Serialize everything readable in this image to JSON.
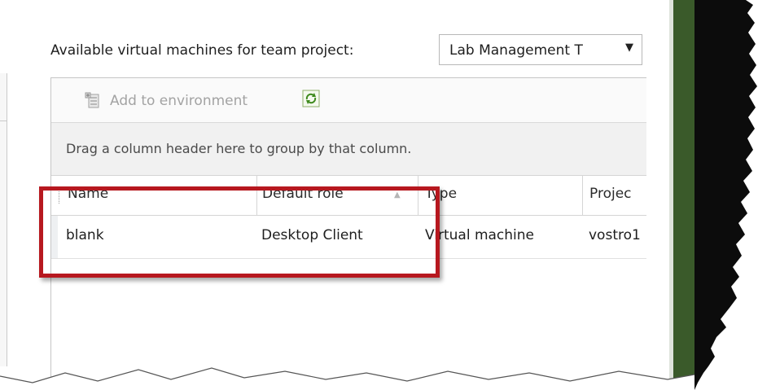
{
  "header": {
    "label": "Available virtual machines for team project:",
    "project_select_value": "Lab Management T"
  },
  "toolbar": {
    "add_to_environment_label": "Add to environment",
    "add_icon": "add-to-environment-icon",
    "refresh_icon": "refresh-icon"
  },
  "grid": {
    "group_hint": "Drag a column header here to group by that column.",
    "columns": [
      {
        "label": "Name"
      },
      {
        "label": "Default role"
      },
      {
        "label": "Type"
      },
      {
        "label": "Projec"
      }
    ],
    "rows": [
      {
        "name": "blank",
        "default_role": "Desktop Client",
        "type": "Virtual machine",
        "project": "vostro1"
      }
    ]
  },
  "colors": {
    "highlight_border": "#b7181f",
    "side_strip": "#3a5a2a"
  }
}
